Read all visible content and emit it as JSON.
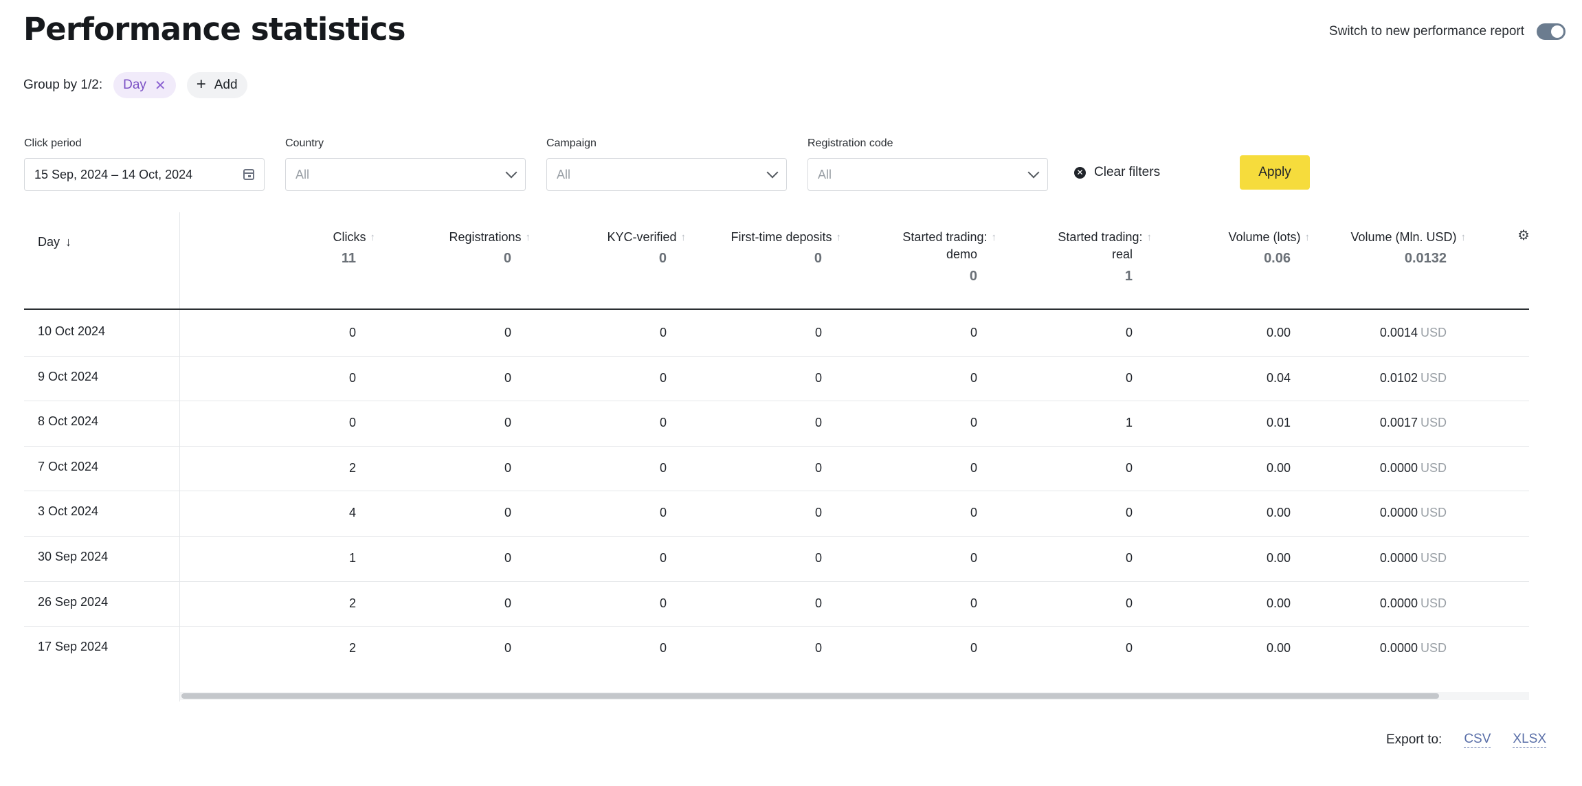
{
  "page": {
    "title": "Performance statistics"
  },
  "switch": {
    "label": "Switch to new performance report",
    "on": true
  },
  "groupby": {
    "label": "Group by 1/2:",
    "chip": "Day",
    "add": "Add"
  },
  "filters": {
    "click_period": {
      "label": "Click period",
      "value": "15 Sep, 2024 – 14 Oct, 2024"
    },
    "country": {
      "label": "Country",
      "placeholder": "All"
    },
    "campaign": {
      "label": "Campaign",
      "placeholder": "All"
    },
    "registration_code": {
      "label": "Registration code",
      "placeholder": "All"
    },
    "clear": "Clear filters",
    "apply": "Apply"
  },
  "table": {
    "day_header": "Day",
    "columns": [
      {
        "l1": "Clicks",
        "l2": "",
        "total": "11"
      },
      {
        "l1": "Registrations",
        "l2": "",
        "total": "0"
      },
      {
        "l1": "KYC-verified",
        "l2": "",
        "total": "0"
      },
      {
        "l1": "First-time deposits",
        "l2": "",
        "total": "0"
      },
      {
        "l1": "Started trading:",
        "l2": "demo",
        "total": "0"
      },
      {
        "l1": "Started trading:",
        "l2": "real",
        "total": "1"
      },
      {
        "l1": "Volume (lots)",
        "l2": "",
        "total": "0.06"
      },
      {
        "l1": "Volume (Mln. USD)",
        "l2": "",
        "total": "0.0132"
      }
    ],
    "currency": "USD",
    "rows": [
      {
        "day": "10 Oct 2024",
        "c": [
          "0",
          "0",
          "0",
          "0",
          "0",
          "0",
          "0.00",
          "0.0014"
        ]
      },
      {
        "day": "9 Oct 2024",
        "c": [
          "0",
          "0",
          "0",
          "0",
          "0",
          "0",
          "0.04",
          "0.0102"
        ]
      },
      {
        "day": "8 Oct 2024",
        "c": [
          "0",
          "0",
          "0",
          "0",
          "0",
          "1",
          "0.01",
          "0.0017"
        ]
      },
      {
        "day": "7 Oct 2024",
        "c": [
          "2",
          "0",
          "0",
          "0",
          "0",
          "0",
          "0.00",
          "0.0000"
        ]
      },
      {
        "day": "3 Oct 2024",
        "c": [
          "4",
          "0",
          "0",
          "0",
          "0",
          "0",
          "0.00",
          "0.0000"
        ]
      },
      {
        "day": "30 Sep 2024",
        "c": [
          "1",
          "0",
          "0",
          "0",
          "0",
          "0",
          "0.00",
          "0.0000"
        ]
      },
      {
        "day": "26 Sep 2024",
        "c": [
          "2",
          "0",
          "0",
          "0",
          "0",
          "0",
          "0.00",
          "0.0000"
        ]
      },
      {
        "day": "17 Sep 2024",
        "c": [
          "2",
          "0",
          "0",
          "0",
          "0",
          "0",
          "0.00",
          "0.0000"
        ]
      }
    ]
  },
  "export": {
    "label": "Export to:",
    "csv": "CSV",
    "xlsx": "XLSX"
  }
}
